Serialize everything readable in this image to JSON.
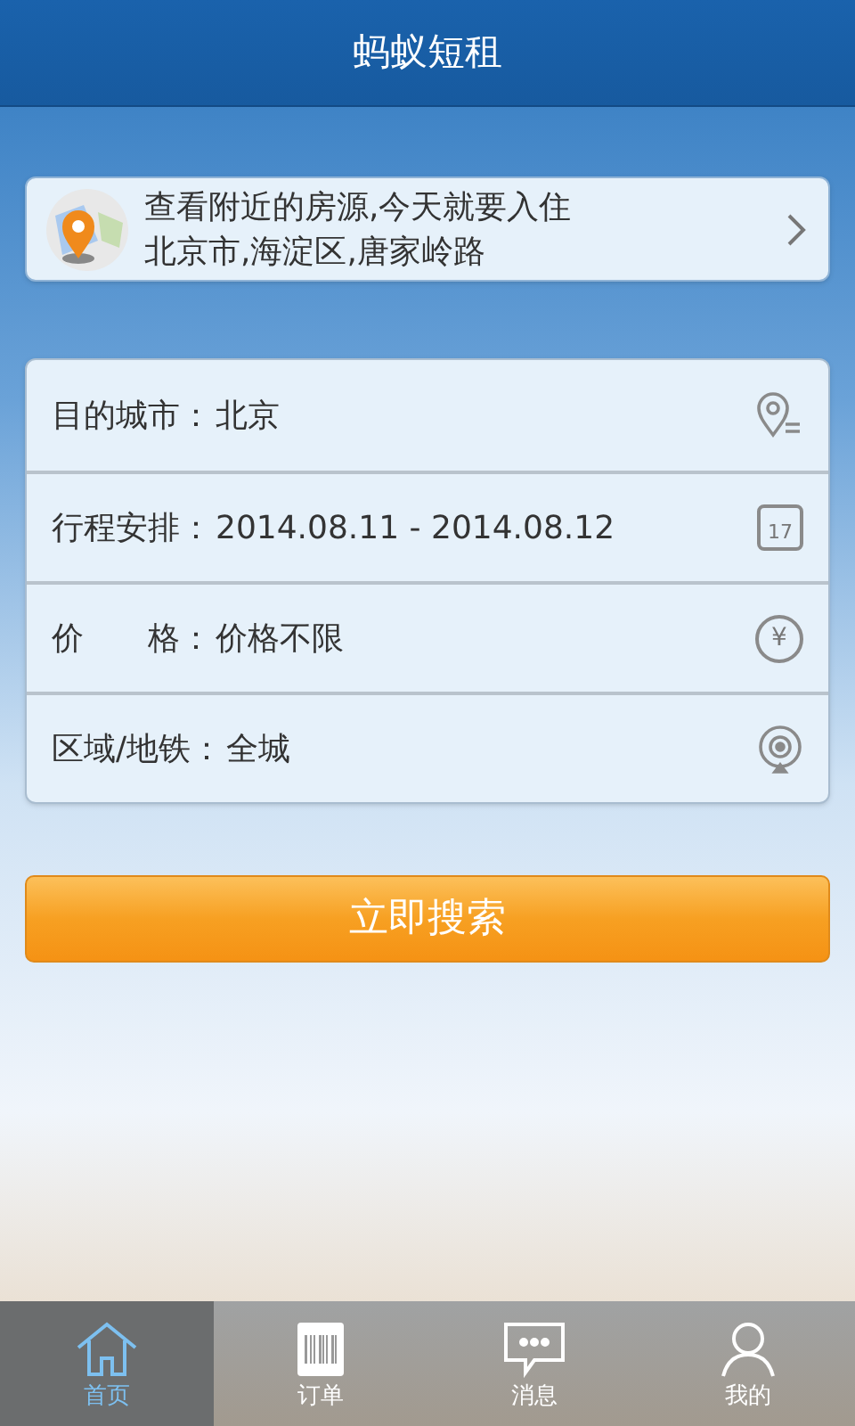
{
  "header": {
    "title": "蚂蚁短租"
  },
  "nearby": {
    "title": "查看附近的房源,今天就要入住",
    "address": "北京市,海淀区,唐家岭路"
  },
  "form": {
    "rows": [
      {
        "kind": "city",
        "label": "目的城市：",
        "value": "北京"
      },
      {
        "kind": "dates",
        "label": "行程安排：",
        "value": "2014.08.11 - 2014.08.12",
        "icon_text": "17"
      },
      {
        "kind": "price",
        "label": "价　　格：",
        "value": "价格不限",
        "icon_text": "¥"
      },
      {
        "kind": "area",
        "label": "区域/地铁：",
        "value": "全城"
      }
    ]
  },
  "search_button": "立即搜索",
  "tabs": [
    {
      "kind": "home",
      "label": "首页",
      "selected": true
    },
    {
      "kind": "orders",
      "label": "订单",
      "selected": false
    },
    {
      "kind": "messages",
      "label": "消息",
      "selected": false
    },
    {
      "kind": "profile",
      "label": "我的",
      "selected": false
    }
  ]
}
